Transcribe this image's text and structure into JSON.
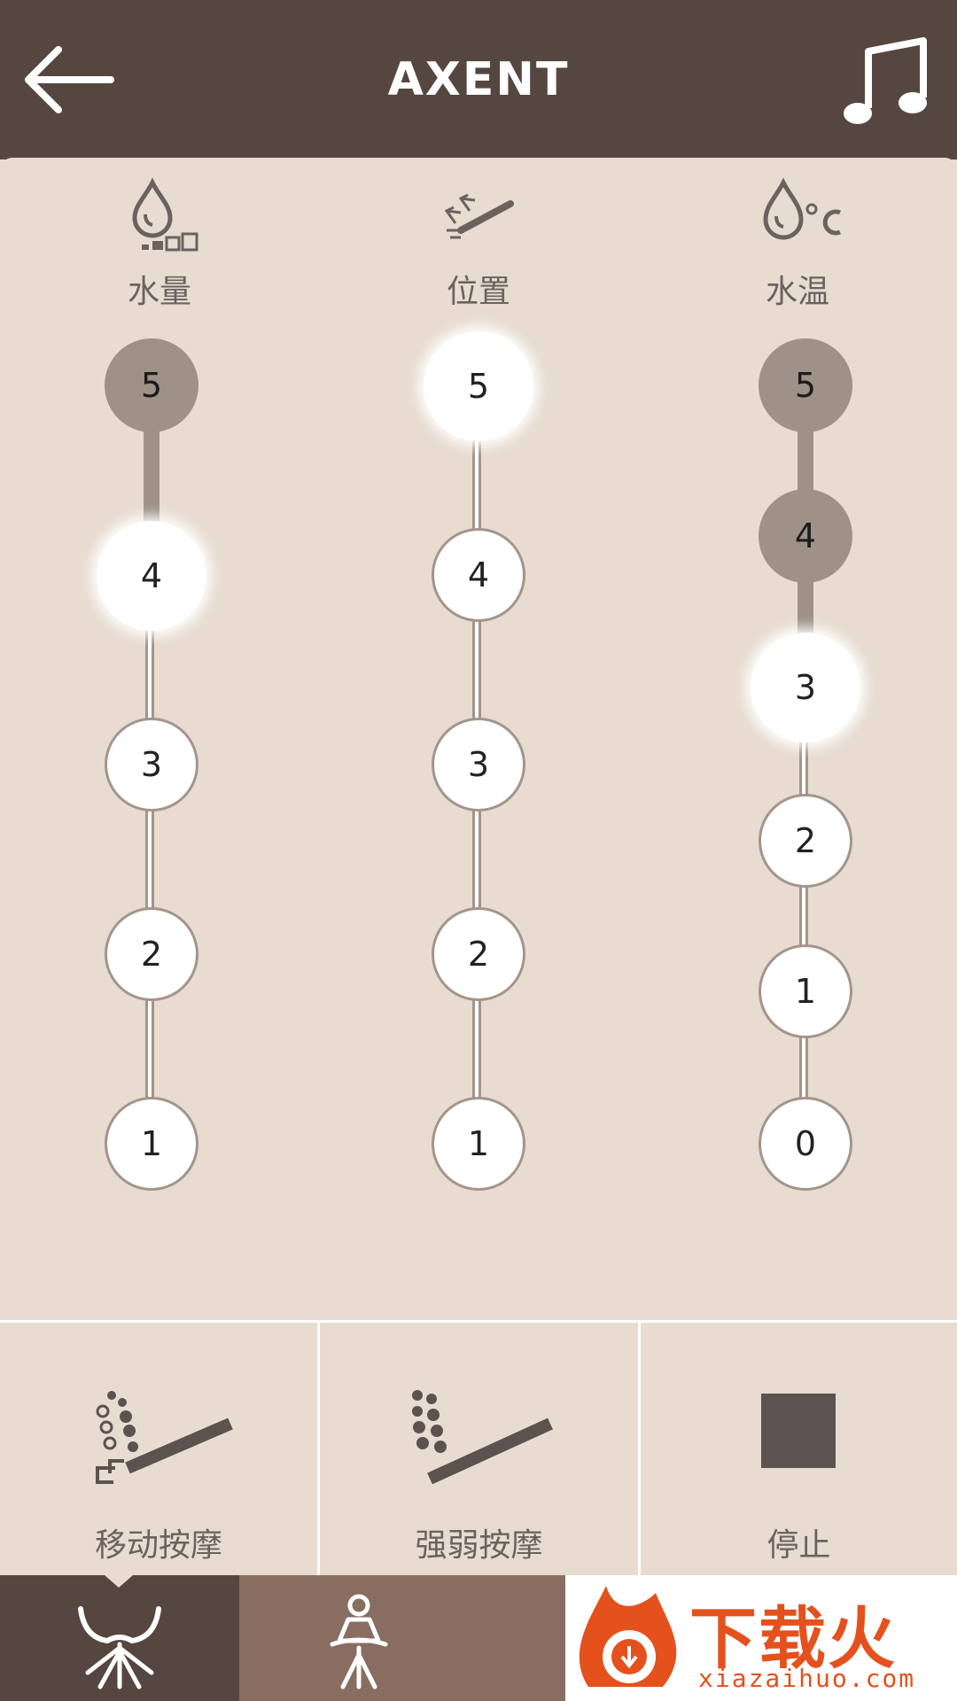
{
  "header": {
    "title": "AXENT"
  },
  "columns": [
    {
      "label": "水量",
      "icon": "water-volume-icon",
      "levels": [
        "5",
        "4",
        "3",
        "2",
        "1"
      ],
      "selected": "4"
    },
    {
      "label": "位置",
      "icon": "nozzle-position-icon",
      "levels": [
        "5",
        "4",
        "3",
        "2",
        "1"
      ],
      "selected": "5"
    },
    {
      "label": "水温",
      "icon": "water-temperature-icon",
      "levels": [
        "5",
        "4",
        "3",
        "2",
        "1",
        "0"
      ],
      "selected": "3"
    }
  ],
  "modes": [
    {
      "label": "移动按摩",
      "icon": "moving-massage-icon"
    },
    {
      "label": "强弱按摩",
      "icon": "pulse-massage-icon"
    },
    {
      "label": "停止",
      "icon": "stop-icon"
    }
  ],
  "nav": [
    {
      "icon": "rear-wash-icon",
      "selected": true
    },
    {
      "icon": "feminine-wash-icon",
      "selected": false
    }
  ],
  "watermark": {
    "text": "下载火",
    "url": "xiazaihuo.com"
  },
  "colors": {
    "header": "#55463f",
    "background": "#e8dcd1",
    "accent": "#9e9188",
    "nav": "#896d61",
    "watermark": "#e4511d"
  }
}
